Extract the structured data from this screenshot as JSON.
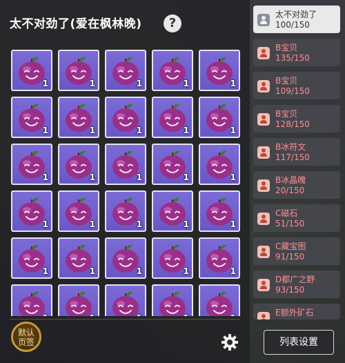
{
  "title": "太不对劲了(爱在枫林晚)",
  "help_icon": "?",
  "grid": {
    "cols": 5,
    "rows": 6,
    "item_icon": "purple-plum-icon",
    "item_count": "1"
  },
  "bottom": {
    "default_tab_line1": "默认",
    "default_tab_line2": "页签",
    "settings_icon": "gear-icon",
    "list_settings_label": "列表设置"
  },
  "sidebar": {
    "items": [
      {
        "name": "太不对劲了",
        "count": "100/150",
        "active": true
      },
      {
        "name": "B宝贝",
        "count": "135/150"
      },
      {
        "name": "B宝贝",
        "count": "109/150"
      },
      {
        "name": "B宝贝",
        "count": "128/150"
      },
      {
        "name": "B冰符文",
        "count": "117/150"
      },
      {
        "name": "B冰晶魄",
        "count": "20/150"
      },
      {
        "name": "C磁石",
        "count": "51/150"
      },
      {
        "name": "C藏宝图",
        "count": "91/150"
      },
      {
        "name": "D都广之野",
        "count": "93/150"
      },
      {
        "name": "E额外矿石",
        "count": ""
      }
    ]
  },
  "colors": {
    "slot_bg": "#7b6bd6",
    "plum": "#9a2f8a",
    "sidebar_text": "#ff8f8f"
  }
}
